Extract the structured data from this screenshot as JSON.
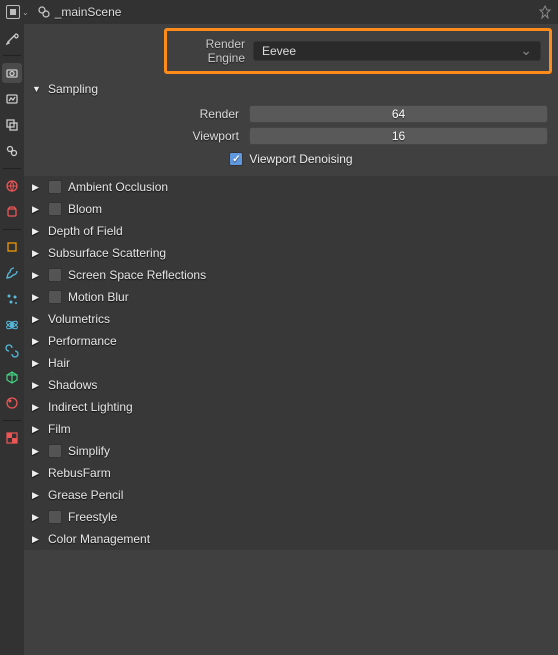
{
  "header": {
    "scene_name": "_mainScene"
  },
  "render_engine": {
    "label": "Render Engine",
    "value": "Eevee"
  },
  "sampling": {
    "title": "Sampling",
    "render_label": "Render",
    "render_value": "64",
    "viewport_label": "Viewport",
    "viewport_value": "16",
    "denoise_label": "Viewport Denoising"
  },
  "panels": [
    {
      "label": "Ambient Occlusion",
      "checkable": true,
      "checked": false
    },
    {
      "label": "Bloom",
      "checkable": true,
      "checked": false
    },
    {
      "label": "Depth of Field",
      "checkable": false
    },
    {
      "label": "Subsurface Scattering",
      "checkable": false
    },
    {
      "label": "Screen Space Reflections",
      "checkable": true,
      "checked": false
    },
    {
      "label": "Motion Blur",
      "checkable": true,
      "checked": false
    },
    {
      "label": "Volumetrics",
      "checkable": false
    },
    {
      "label": "Performance",
      "checkable": false
    },
    {
      "label": "Hair",
      "checkable": false
    },
    {
      "label": "Shadows",
      "checkable": false
    },
    {
      "label": "Indirect Lighting",
      "checkable": false
    },
    {
      "label": "Film",
      "checkable": false
    },
    {
      "label": "Simplify",
      "checkable": true,
      "checked": false
    },
    {
      "label": "RebusFarm",
      "checkable": false
    },
    {
      "label": "Grease Pencil",
      "checkable": false
    },
    {
      "label": "Freestyle",
      "checkable": true,
      "checked": false
    },
    {
      "label": "Color Management",
      "checkable": false
    }
  ],
  "sidebar_icons": [
    {
      "name": "tool-icon",
      "color": "#ccc",
      "divider_after": true
    },
    {
      "name": "render-icon",
      "color": "#ccc",
      "active": true
    },
    {
      "name": "output-icon",
      "color": "#ccc"
    },
    {
      "name": "viewlayer-icon",
      "color": "#ccc"
    },
    {
      "name": "scene-icon",
      "color": "#ccc",
      "divider_after": true
    },
    {
      "name": "world-icon",
      "color": "#e55"
    },
    {
      "name": "collection-icon",
      "color": "#e55",
      "divider_after": true
    },
    {
      "name": "object-icon",
      "color": "#e90"
    },
    {
      "name": "modifier-icon",
      "color": "#5bd"
    },
    {
      "name": "particle-icon",
      "color": "#5bd"
    },
    {
      "name": "physics-icon",
      "color": "#5bd"
    },
    {
      "name": "constraint-icon",
      "color": "#5bd"
    },
    {
      "name": "mesh-icon",
      "color": "#4d8"
    },
    {
      "name": "material-icon",
      "color": "#e55",
      "divider_after": true
    },
    {
      "name": "texture-icon",
      "color": "#e55"
    }
  ]
}
